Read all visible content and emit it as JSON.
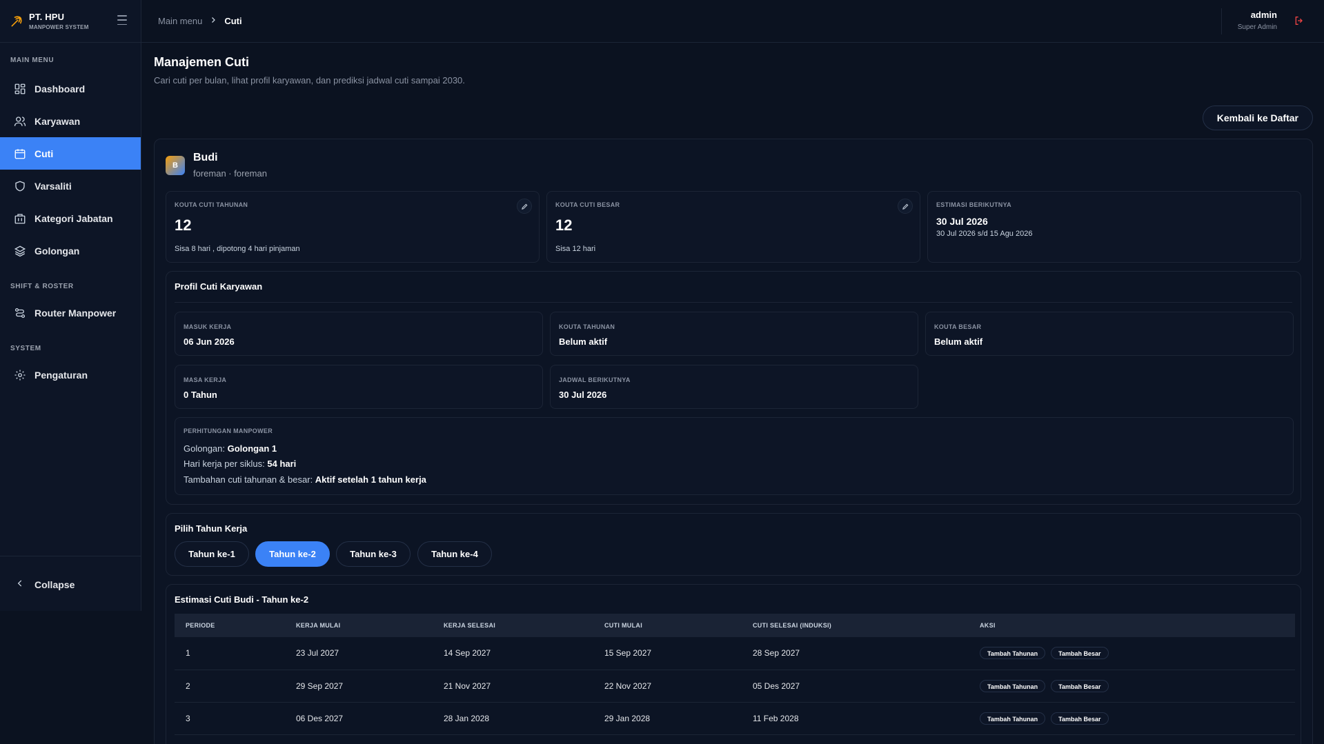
{
  "brand": {
    "name": "PT. HPU",
    "subtitle": "MANPOWER SYSTEM"
  },
  "sidebar": {
    "sections": [
      {
        "label": "MAIN MENU"
      },
      {
        "label": "SHIFT & ROSTER"
      },
      {
        "label": "SYSTEM"
      }
    ],
    "items": [
      {
        "label": "Dashboard",
        "icon": "dashboard-icon"
      },
      {
        "label": "Karyawan",
        "icon": "users-icon"
      },
      {
        "label": "Cuti",
        "icon": "calendar-icon",
        "active": true
      },
      {
        "label": "Varsaliti",
        "icon": "shield-icon"
      },
      {
        "label": "Kategori Jabatan",
        "icon": "building-icon"
      },
      {
        "label": "Golongan",
        "icon": "layers-icon"
      },
      {
        "label": "Router Manpower",
        "icon": "route-icon"
      },
      {
        "label": "Pengaturan",
        "icon": "gear-icon"
      }
    ],
    "collapse_label": "Collapse"
  },
  "topbar": {
    "breadcrumb": [
      "Main menu",
      "Cuti"
    ],
    "user": {
      "name": "admin",
      "role": "Super Admin"
    }
  },
  "page": {
    "title": "Manajemen Cuti",
    "subtitle": "Cari cuti per bulan, lihat profil karyawan, dan prediksi jadwal cuti sampai 2030.",
    "back_label": "Kembali ke Daftar"
  },
  "employee": {
    "initial": "B",
    "name": "Budi",
    "role": "foreman · foreman"
  },
  "quota_cards": {
    "tahunan": {
      "label": "KOUTA CUTI TAHUNAN",
      "value": "12",
      "note": "Sisa 8 hari , dipotong 4 hari pinjaman"
    },
    "besar": {
      "label": "KOUTA CUTI BESAR",
      "value": "12",
      "note": "Sisa 12 hari"
    },
    "estimasi": {
      "label": "ESTIMASI BERIKUTNYA",
      "date": "30 Jul 2026",
      "range": "30 Jul 2026 s/d 15 Agu 2026"
    }
  },
  "profile": {
    "title": "Profil Cuti Karyawan",
    "fields": [
      {
        "label": "MASUK KERJA",
        "value": "06 Jun 2026"
      },
      {
        "label": "KOUTA TAHUNAN",
        "value": "Belum aktif"
      },
      {
        "label": "KOUTA BESAR",
        "value": "Belum aktif"
      },
      {
        "label": "MASA KERJA",
        "value": "0 Tahun"
      },
      {
        "label": "JADWAL BERIKUTNYA",
        "value": "30 Jul 2026"
      }
    ],
    "calc": {
      "label": "PERHITUNGAN MANPOWER",
      "lines": [
        {
          "key": "Golongan: ",
          "value": "Golongan 1"
        },
        {
          "key": "Hari kerja per siklus: ",
          "value": "54 hari"
        },
        {
          "key": "Tambahan cuti tahunan & besar: ",
          "value": "Aktif setelah 1 tahun kerja"
        }
      ]
    }
  },
  "year_picker": {
    "title": "Pilih Tahun Kerja",
    "options": [
      "Tahun ke-1",
      "Tahun ke-2",
      "Tahun ke-3",
      "Tahun ke-4"
    ],
    "selected": "Tahun ke-2"
  },
  "estimate_table": {
    "title": "Estimasi Cuti Budi - Tahun ke-2",
    "columns": [
      "PERIODE",
      "KERJA MULAI",
      "KERJA SELESAI",
      "CUTI MULAI",
      "CUTI SELESAI (INDUKSI)",
      "AKSI"
    ],
    "rows": [
      [
        "1",
        "23 Jul 2027",
        "14 Sep 2027",
        "15 Sep 2027",
        "28 Sep 2027"
      ],
      [
        "2",
        "29 Sep 2027",
        "21 Nov 2027",
        "22 Nov 2027",
        "05 Des 2027"
      ],
      [
        "3",
        "06 Des 2027",
        "28 Jan 2028",
        "29 Jan 2028",
        "11 Feb 2028"
      ]
    ],
    "actions": [
      "Tambah Tahunan",
      "Tambah Besar"
    ]
  },
  "colors": {
    "accent": "#3b82f6",
    "background": "#0b1220",
    "logout": "#ef4444",
    "brand_icon": "#f59e0b"
  }
}
